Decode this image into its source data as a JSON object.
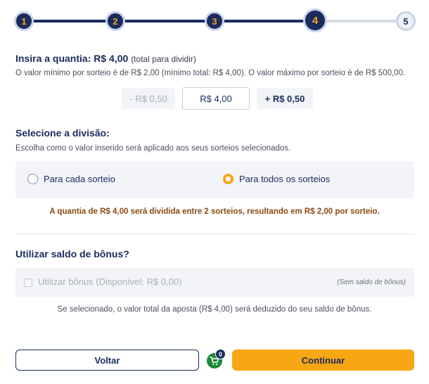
{
  "stepper": {
    "steps": [
      {
        "label": "1"
      },
      {
        "label": "2"
      },
      {
        "label": "3"
      },
      {
        "label": "4"
      },
      {
        "label": "5"
      }
    ],
    "current_step": 4
  },
  "amount": {
    "title": "Insira a quantia: R$ 4,00",
    "title_sub": "(total para dividir)",
    "limits_text": "O valor mínimo por sorteio é de R$ 2,00 (mínimo total: R$ 4,00). O valor máximo por sorteio é de R$ 500,00.",
    "decrement_label": "- R$ 0,50",
    "value": "R$ 4,00",
    "increment_label": "+ R$ 0,50"
  },
  "division": {
    "title": "Selecione a divisão:",
    "description": "Escolha como o valor inserido será aplicado aos seus sorteios selecionados.",
    "options": [
      {
        "label": "Para cada sorteio",
        "selected": false
      },
      {
        "label": "Para todos os sorteios",
        "selected": true
      }
    ],
    "note": "A quantia de R$ 4,00 será dividida entre 2 sorteios, resultando em R$ 2,00 por sorteio."
  },
  "bonus": {
    "title": "Utilizar saldo de bônus?",
    "checkbox_label": "Utilizar bônus (Disponível: R$ 0,00)",
    "no_balance_label": "(Sem saldo de bônus)",
    "note": "Se selecionado, o valor total da aposta (R$ 4,00) será deduzido do seu saldo de bônus."
  },
  "footer": {
    "back_label": "Voltar",
    "cart_count": "0",
    "continue_label": "Continuar"
  },
  "colors": {
    "primary": "#1a2b5e",
    "accent": "#f7a614",
    "warning_text": "#8a4a12",
    "cart_green": "#1a8a3a"
  }
}
